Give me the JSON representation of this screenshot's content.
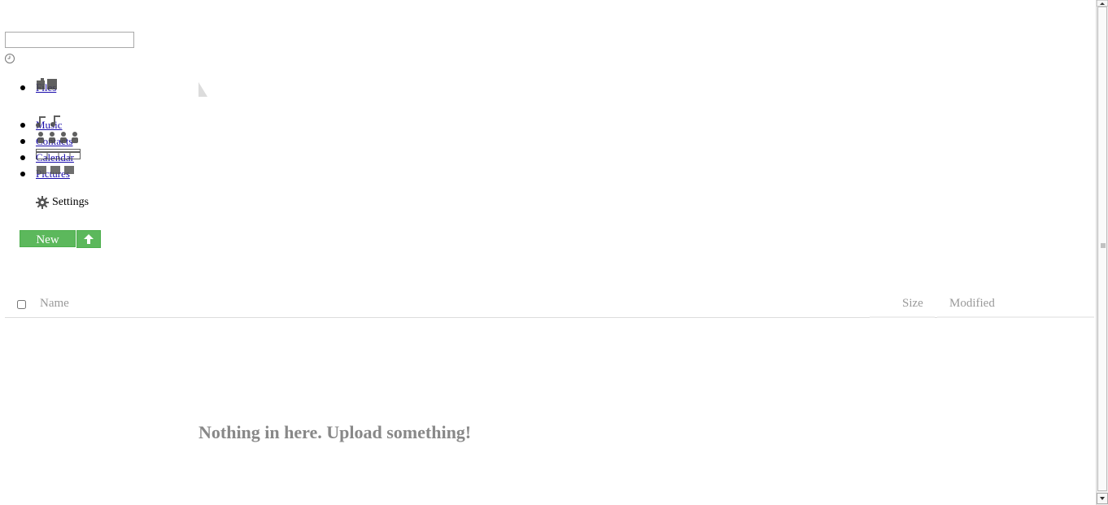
{
  "search": {
    "value": "",
    "placeholder": ""
  },
  "nav": {
    "items": [
      {
        "label": "Files",
        "icon": "folder-icon"
      },
      {
        "label": "Music",
        "icon": "music-icon"
      },
      {
        "label": "Contacts",
        "icon": "people-icon"
      },
      {
        "label": "Calendar",
        "icon": "calendar-icon"
      },
      {
        "label": "Pictures",
        "icon": "pictures-icon"
      }
    ],
    "settings_label": "Settings"
  },
  "toolbar": {
    "new_label": "New",
    "upload_icon": "upload-arrow-icon"
  },
  "file_list": {
    "columns": {
      "name": "Name",
      "size": "Size",
      "modified": "Modified"
    },
    "empty_message": "Nothing in here. Upload something!"
  },
  "colors": {
    "accent_green": "#5cb85c",
    "muted_text": "#999999",
    "empty_text": "#888888"
  }
}
